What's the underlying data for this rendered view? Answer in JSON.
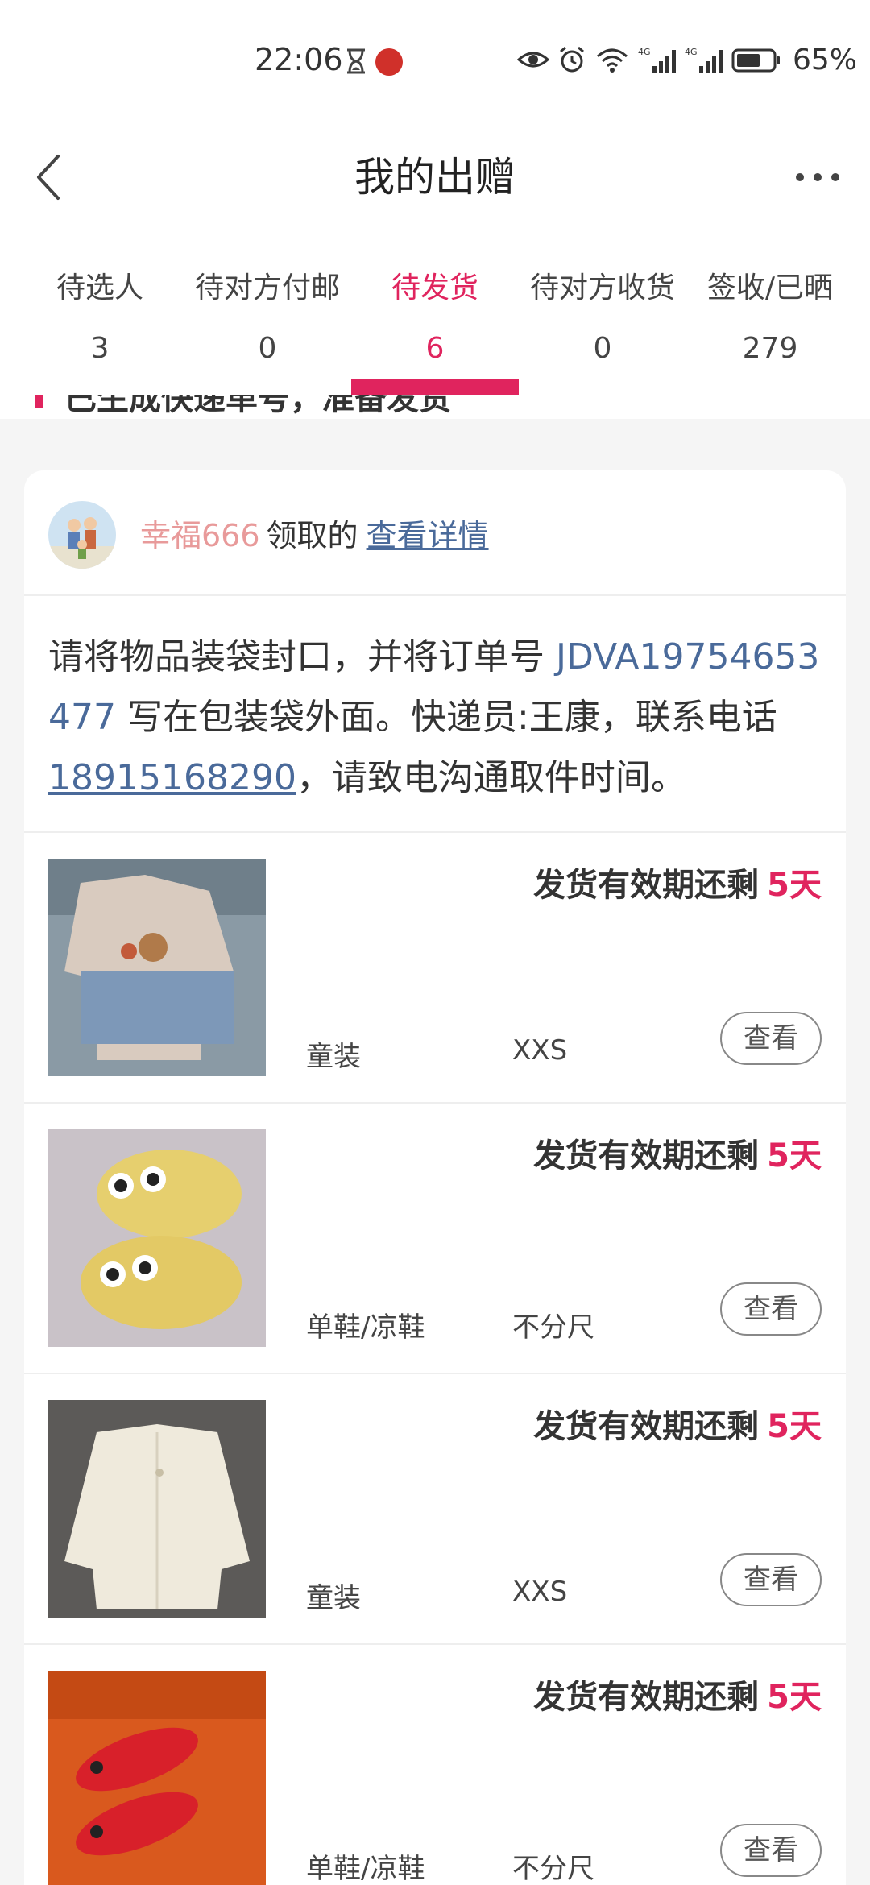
{
  "status_bar": {
    "time": "22:06",
    "battery": "65%",
    "icons": [
      "hourglass-icon",
      "app-notification-icon",
      "eye-icon",
      "alarm-icon",
      "wifi-icon",
      "signal-4g-icon",
      "signal-4g-icon",
      "battery-icon"
    ]
  },
  "nav": {
    "title": "我的出赠",
    "back_icon": "chevron-left-icon",
    "more_icon": "more-dots-icon"
  },
  "tabs": [
    {
      "label": "待选人",
      "count": "3",
      "active": false
    },
    {
      "label": "待对方付邮",
      "count": "0",
      "active": false
    },
    {
      "label": "待发货",
      "count": "6",
      "active": true
    },
    {
      "label": "待对方收货",
      "count": "0",
      "active": false
    },
    {
      "label": "签收/已晒",
      "count": "279",
      "active": false
    }
  ],
  "accent_color": "#e0245e",
  "peek_text": "已生成快递单号，准备发货",
  "order": {
    "receiver_name": "幸福666",
    "received_label": "领取的",
    "detail_link": "查看详情",
    "instruction_prefix": "请将物品装袋封口，并将订单号 ",
    "order_number": "JDVA19754653477",
    "instruction_middle": " 写在包装袋外面。快递员:王康，联系电话",
    "phone": "18915168290",
    "instruction_suffix": "，请致电沟通取件时间。"
  },
  "items": [
    {
      "deadline_label": "发货有效期还剩",
      "deadline_days": "5天",
      "category": "童装",
      "size": "XXS",
      "view_label": "查看"
    },
    {
      "deadline_label": "发货有效期还剩",
      "deadline_days": "5天",
      "category": "单鞋/凉鞋",
      "size": "不分尺",
      "view_label": "查看"
    },
    {
      "deadline_label": "发货有效期还剩",
      "deadline_days": "5天",
      "category": "童装",
      "size": "XXS",
      "view_label": "查看"
    },
    {
      "deadline_label": "发货有效期还剩",
      "deadline_days": "5天",
      "category": "单鞋/凉鞋",
      "size": "不分尺",
      "view_label": "查看"
    }
  ]
}
